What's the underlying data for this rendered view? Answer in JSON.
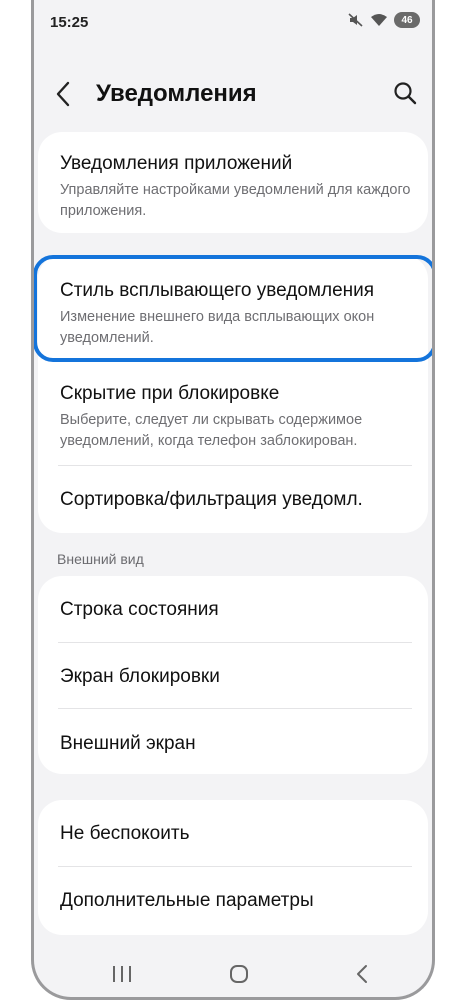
{
  "status_bar": {
    "time": "15:25",
    "battery": "46",
    "icons": [
      "mute-icon",
      "wifi-icon",
      "battery-icon"
    ]
  },
  "header": {
    "title": "Уведомления",
    "back_icon": "chevron-left-icon",
    "search_icon": "search-icon"
  },
  "group1": {
    "app_notifications": {
      "title": "Уведомления приложений",
      "subtitle": "Управляйте настройками уведомлений для каждого приложения."
    }
  },
  "group2": {
    "popup_style": {
      "title": "Стиль всплывающего уведомления",
      "subtitle": "Изменение внешнего вида всплывающих окон уведомлений."
    },
    "hide_on_lock": {
      "title": "Скрытие при блокировке",
      "subtitle": "Выберите, следует ли скрывать содержимое уведомлений, когда телефон заблокирован."
    },
    "sort_filter": {
      "title": "Сортировка/фильтрация уведомл."
    }
  },
  "appearance": {
    "label": "Внешний вид",
    "items": [
      "Строка состояния",
      "Экран блокировки",
      "Внешний экран"
    ]
  },
  "group4": {
    "items": [
      "Не беспокоить",
      "Дополнительные параметры"
    ]
  },
  "colors": {
    "highlight": "#1474db",
    "background": "#f3f3f5",
    "card": "#ffffff"
  },
  "navbar": {
    "icons": [
      "recent-apps-icon",
      "home-icon",
      "back-icon"
    ]
  }
}
